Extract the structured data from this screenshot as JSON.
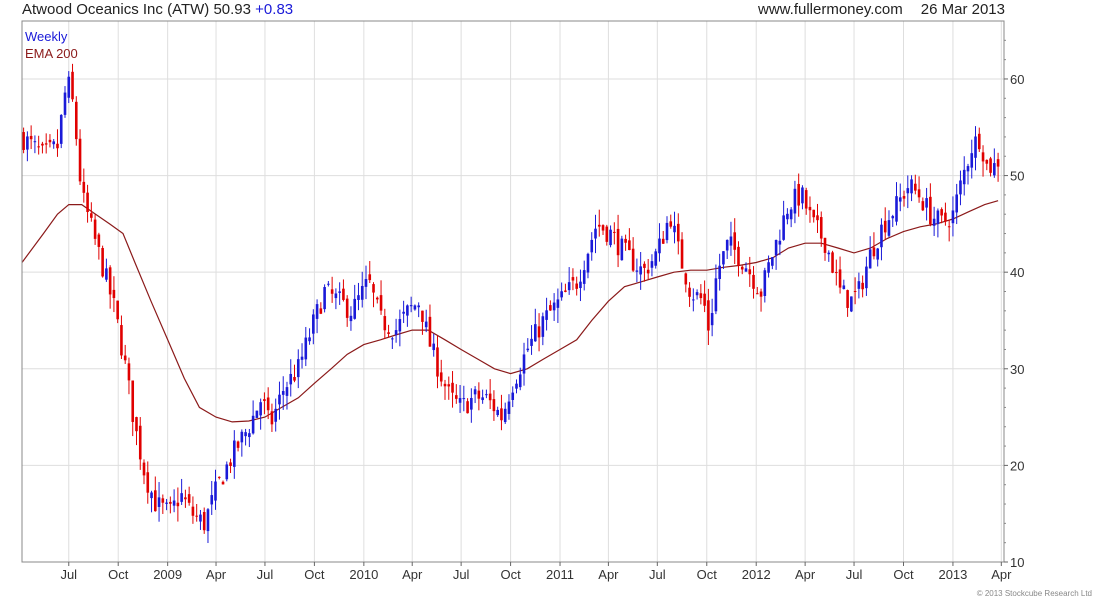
{
  "header": {
    "company": "Atwood Oceanics Inc (ATW)",
    "price": "50.93",
    "change": "+0.83",
    "site": "www.fullermoney.com",
    "date": "26 Mar 2013"
  },
  "legend": {
    "weekly": "Weekly",
    "ema": "EMA 200"
  },
  "copyright": "© 2013 Stockcube Research Ltd",
  "colors": {
    "up": "#1a1ad8",
    "down": "#e00000",
    "ema": "#8b1a1a",
    "grid": "#dedede",
    "frame": "#888888"
  },
  "chart_data": {
    "type": "candlestick",
    "period": "weekly",
    "ylim": [
      10,
      66
    ],
    "yticks": [
      10,
      20,
      30,
      40,
      50,
      60
    ],
    "xticks": [
      "Jul",
      "Oct",
      "2009",
      "Apr",
      "Jul",
      "Oct",
      "2010",
      "Apr",
      "Jul",
      "Oct",
      "2011",
      "Apr",
      "Jul",
      "Oct",
      "2012",
      "Apr",
      "Jul",
      "Oct",
      "2013",
      "Apr"
    ],
    "xlim": [
      "2008-04-05",
      "2013-04-06"
    ],
    "tick_dates": [
      "2008-07-01",
      "2008-10-01",
      "2009-01-01",
      "2009-04-01",
      "2009-07-01",
      "2009-10-01",
      "2010-01-01",
      "2010-04-01",
      "2010-07-01",
      "2010-10-01",
      "2011-01-01",
      "2011-04-01",
      "2011-07-01",
      "2011-10-01",
      "2012-01-01",
      "2012-04-01",
      "2012-07-01",
      "2012-10-01",
      "2013-01-01",
      "2013-04-01"
    ],
    "price_path": [
      [
        "2008-04-05",
        54
      ],
      [
        "2008-05-15",
        52
      ],
      [
        "2008-06-10",
        53
      ],
      [
        "2008-06-28",
        60
      ],
      [
        "2008-07-10",
        57
      ],
      [
        "2008-07-25",
        48
      ],
      [
        "2008-08-15",
        44
      ],
      [
        "2008-09-05",
        40
      ],
      [
        "2008-09-25",
        36
      ],
      [
        "2008-10-15",
        30
      ],
      [
        "2008-11-01",
        24
      ],
      [
        "2008-11-20",
        19
      ],
      [
        "2008-12-10",
        16
      ],
      [
        "2009-01-05",
        15
      ],
      [
        "2009-01-25",
        17
      ],
      [
        "2009-02-15",
        15
      ],
      [
        "2009-03-10",
        14
      ],
      [
        "2009-04-05",
        18
      ],
      [
        "2009-05-01",
        21
      ],
      [
        "2009-06-01",
        24
      ],
      [
        "2009-06-25",
        27
      ],
      [
        "2009-07-10",
        24
      ],
      [
        "2009-08-05",
        28
      ],
      [
        "2009-09-01",
        30
      ],
      [
        "2009-10-01",
        35
      ],
      [
        "2009-10-20",
        38
      ],
      [
        "2009-11-15",
        37
      ],
      [
        "2009-12-10",
        36
      ],
      [
        "2010-01-10",
        39
      ],
      [
        "2010-02-01",
        35
      ],
      [
        "2010-03-01",
        34
      ],
      [
        "2010-03-25",
        36
      ],
      [
        "2010-04-15",
        37
      ],
      [
        "2010-05-01",
        33
      ],
      [
        "2010-05-20",
        30
      ],
      [
        "2010-06-10",
        27
      ],
      [
        "2010-07-01",
        26
      ],
      [
        "2010-07-25",
        27
      ],
      [
        "2010-08-15",
        27
      ],
      [
        "2010-09-01",
        26
      ],
      [
        "2010-09-15",
        25
      ],
      [
        "2010-10-01",
        28
      ],
      [
        "2010-11-01",
        32
      ],
      [
        "2010-12-01",
        35
      ],
      [
        "2011-01-01",
        37
      ],
      [
        "2011-02-01",
        39
      ],
      [
        "2011-02-20",
        42
      ],
      [
        "2011-03-10",
        45
      ],
      [
        "2011-04-05",
        44
      ],
      [
        "2011-05-01",
        42
      ],
      [
        "2011-06-05",
        40
      ],
      [
        "2011-07-01",
        42
      ],
      [
        "2011-07-25",
        46
      ],
      [
        "2011-08-10",
        42
      ],
      [
        "2011-09-01",
        38
      ],
      [
        "2011-09-25",
        37
      ],
      [
        "2011-10-05",
        34
      ],
      [
        "2011-10-20",
        40
      ],
      [
        "2011-11-10",
        43
      ],
      [
        "2011-12-10",
        41
      ],
      [
        "2012-01-10",
        38
      ],
      [
        "2012-02-01",
        42
      ],
      [
        "2012-03-01",
        47
      ],
      [
        "2012-03-25",
        48
      ],
      [
        "2012-04-15",
        45
      ],
      [
        "2012-05-10",
        43
      ],
      [
        "2012-06-05",
        38
      ],
      [
        "2012-06-25",
        37
      ],
      [
        "2012-07-10",
        38
      ],
      [
        "2012-08-01",
        42
      ],
      [
        "2012-08-25",
        45
      ],
      [
        "2012-09-20",
        47
      ],
      [
        "2012-10-10",
        49
      ],
      [
        "2012-10-30",
        48
      ],
      [
        "2012-11-20",
        46
      ],
      [
        "2012-12-10",
        45
      ],
      [
        "2013-01-01",
        46
      ],
      [
        "2013-01-20",
        50
      ],
      [
        "2013-02-05",
        53
      ],
      [
        "2013-02-20",
        54
      ],
      [
        "2013-03-05",
        51
      ],
      [
        "2013-03-26",
        50.93
      ]
    ],
    "ema_path": [
      [
        "2008-04-05",
        41
      ],
      [
        "2008-05-15",
        44
      ],
      [
        "2008-06-10",
        46
      ],
      [
        "2008-07-01",
        47
      ],
      [
        "2008-07-25",
        47
      ],
      [
        "2008-08-20",
        46
      ],
      [
        "2008-09-15",
        45
      ],
      [
        "2008-10-10",
        44
      ],
      [
        "2008-11-01",
        41
      ],
      [
        "2008-12-01",
        37
      ],
      [
        "2009-01-01",
        33
      ],
      [
        "2009-02-01",
        29
      ],
      [
        "2009-03-01",
        26
      ],
      [
        "2009-04-01",
        25
      ],
      [
        "2009-05-01",
        24.5
      ],
      [
        "2009-06-01",
        24.6
      ],
      [
        "2009-07-01",
        25
      ],
      [
        "2009-08-01",
        26
      ],
      [
        "2009-09-01",
        27
      ],
      [
        "2009-10-01",
        28.5
      ],
      [
        "2009-11-01",
        30
      ],
      [
        "2009-12-01",
        31.5
      ],
      [
        "2010-01-01",
        32.5
      ],
      [
        "2010-02-01",
        33
      ],
      [
        "2010-03-01",
        33.5
      ],
      [
        "2010-04-01",
        34
      ],
      [
        "2010-05-01",
        34
      ],
      [
        "2010-06-01",
        33
      ],
      [
        "2010-07-01",
        32
      ],
      [
        "2010-08-01",
        31
      ],
      [
        "2010-09-01",
        30
      ],
      [
        "2010-10-01",
        29.5
      ],
      [
        "2010-11-01",
        30
      ],
      [
        "2010-12-01",
        31
      ],
      [
        "2011-01-01",
        32
      ],
      [
        "2011-02-01",
        33
      ],
      [
        "2011-03-01",
        35
      ],
      [
        "2011-04-01",
        37
      ],
      [
        "2011-05-01",
        38.5
      ],
      [
        "2011-06-01",
        39
      ],
      [
        "2011-07-01",
        39.5
      ],
      [
        "2011-08-01",
        40
      ],
      [
        "2011-09-01",
        40.2
      ],
      [
        "2011-10-01",
        40.2
      ],
      [
        "2011-11-01",
        40.5
      ],
      [
        "2011-12-01",
        40.7
      ],
      [
        "2012-01-01",
        41
      ],
      [
        "2012-02-01",
        41.5
      ],
      [
        "2012-03-01",
        42.5
      ],
      [
        "2012-04-01",
        43
      ],
      [
        "2012-05-01",
        43
      ],
      [
        "2012-06-01",
        42.5
      ],
      [
        "2012-07-01",
        42
      ],
      [
        "2012-08-01",
        42.5
      ],
      [
        "2012-09-01",
        43.5
      ],
      [
        "2012-10-01",
        44.2
      ],
      [
        "2012-11-01",
        44.7
      ],
      [
        "2012-12-01",
        45
      ],
      [
        "2013-01-01",
        45.5
      ],
      [
        "2013-02-01",
        46.3
      ],
      [
        "2013-03-01",
        47
      ],
      [
        "2013-03-26",
        47.4
      ]
    ]
  }
}
